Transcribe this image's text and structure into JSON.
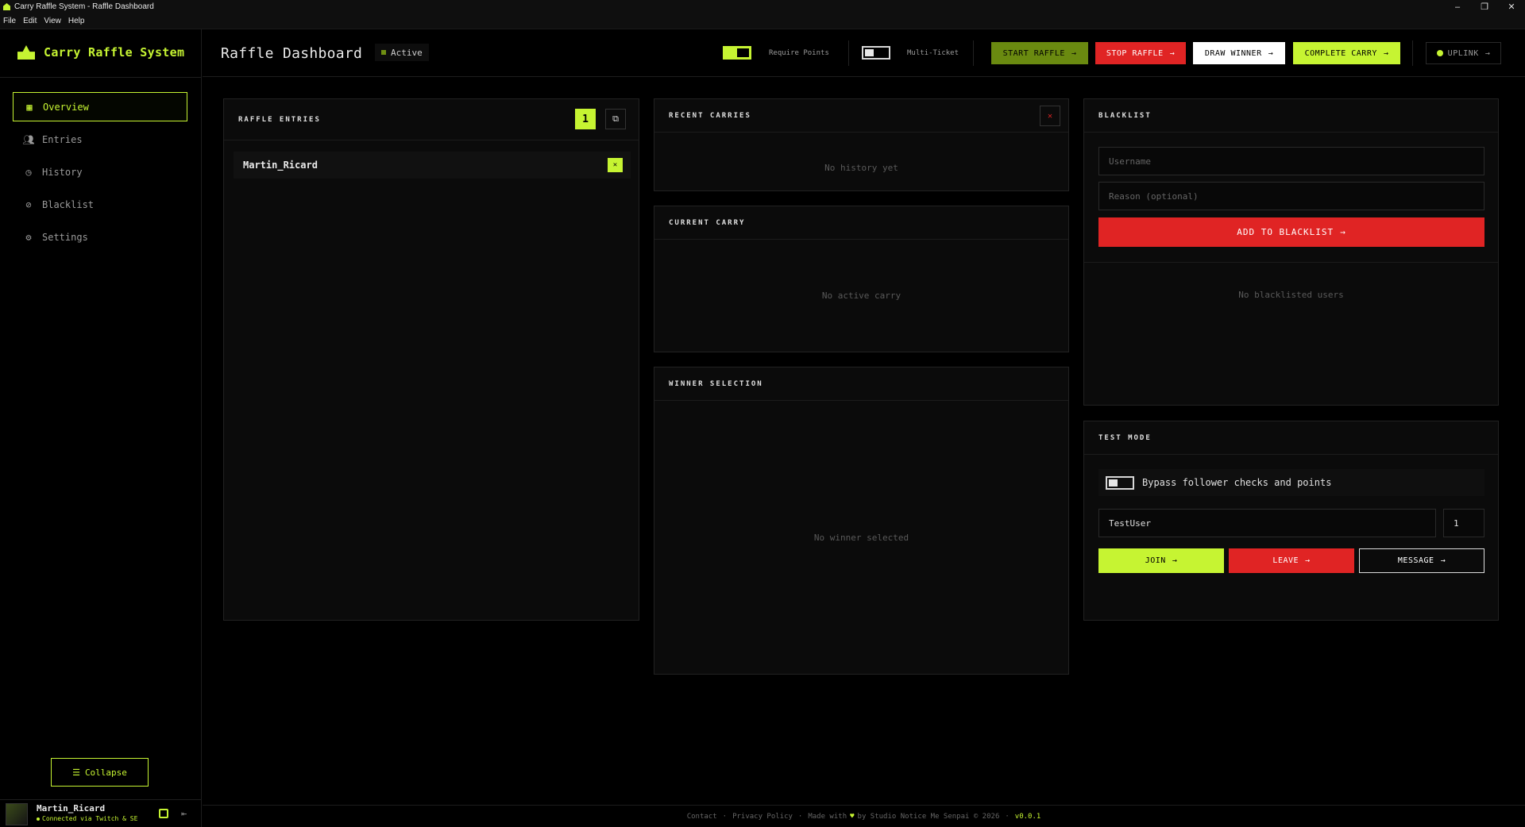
{
  "window": {
    "title": "Carry Raffle System - Raffle Dashboard",
    "menu": [
      "File",
      "Edit",
      "View",
      "Help"
    ],
    "controls": [
      "–",
      "❐",
      "✕"
    ]
  },
  "sidebar": {
    "brand": "Carry Raffle System",
    "items": [
      {
        "label": "Overview",
        "icon": "grid-icon",
        "active": true
      },
      {
        "label": "Entries",
        "icon": "users-icon",
        "active": false
      },
      {
        "label": "History",
        "icon": "history-icon",
        "active": false
      },
      {
        "label": "Blacklist",
        "icon": "ban-icon",
        "active": false
      },
      {
        "label": "Settings",
        "icon": "gear-icon",
        "active": false
      }
    ],
    "collapse_label": "Collapse",
    "user": {
      "name": "Martin_Ricard",
      "status": "Connected via Twitch & SE"
    }
  },
  "header": {
    "title": "Raffle Dashboard",
    "status": "Active",
    "require_points_label": "Require Points",
    "require_points_on": true,
    "multi_ticket_label": "Multi-Ticket",
    "multi_ticket_on": false,
    "buttons": {
      "start": "START RAFFLE",
      "stop": "STOP RAFFLE",
      "draw": "DRAW WINNER",
      "complete": "COMPLETE CARRY",
      "uplink": "UPLINK"
    },
    "arrow": "→"
  },
  "entries_panel": {
    "title": "RAFFLE ENTRIES",
    "count": "1",
    "entries": [
      "Martin_Ricard"
    ],
    "remove_glyph": "✕"
  },
  "recent_carries": {
    "title": "RECENT CARRIES",
    "empty": "No history yet",
    "clear_glyph": "✕"
  },
  "current_carry": {
    "title": "CURRENT CARRY",
    "empty": "No active carry"
  },
  "winner_selection": {
    "title": "WINNER SELECTION",
    "empty": "No winner selected"
  },
  "blacklist": {
    "title": "BLACKLIST",
    "username_placeholder": "Username",
    "reason_placeholder": "Reason (optional)",
    "add_label": "ADD TO BLACKLIST",
    "empty": "No blacklisted users"
  },
  "test_mode": {
    "title": "TEST MODE",
    "bypass_label": "Bypass follower checks and points",
    "bypass_on": false,
    "username": "TestUser",
    "quantity": "1",
    "join": "JOIN",
    "leave": "LEAVE",
    "message": "MESSAGE"
  },
  "footer": {
    "contact": "Contact",
    "privacy": "Privacy Policy",
    "made_with": "Made with",
    "by": "by Studio Notice Me Senpai © 2026",
    "version": "v0.0.1"
  },
  "colors": {
    "accent": "#c6f432",
    "danger": "#e02424",
    "background": "#000000"
  }
}
